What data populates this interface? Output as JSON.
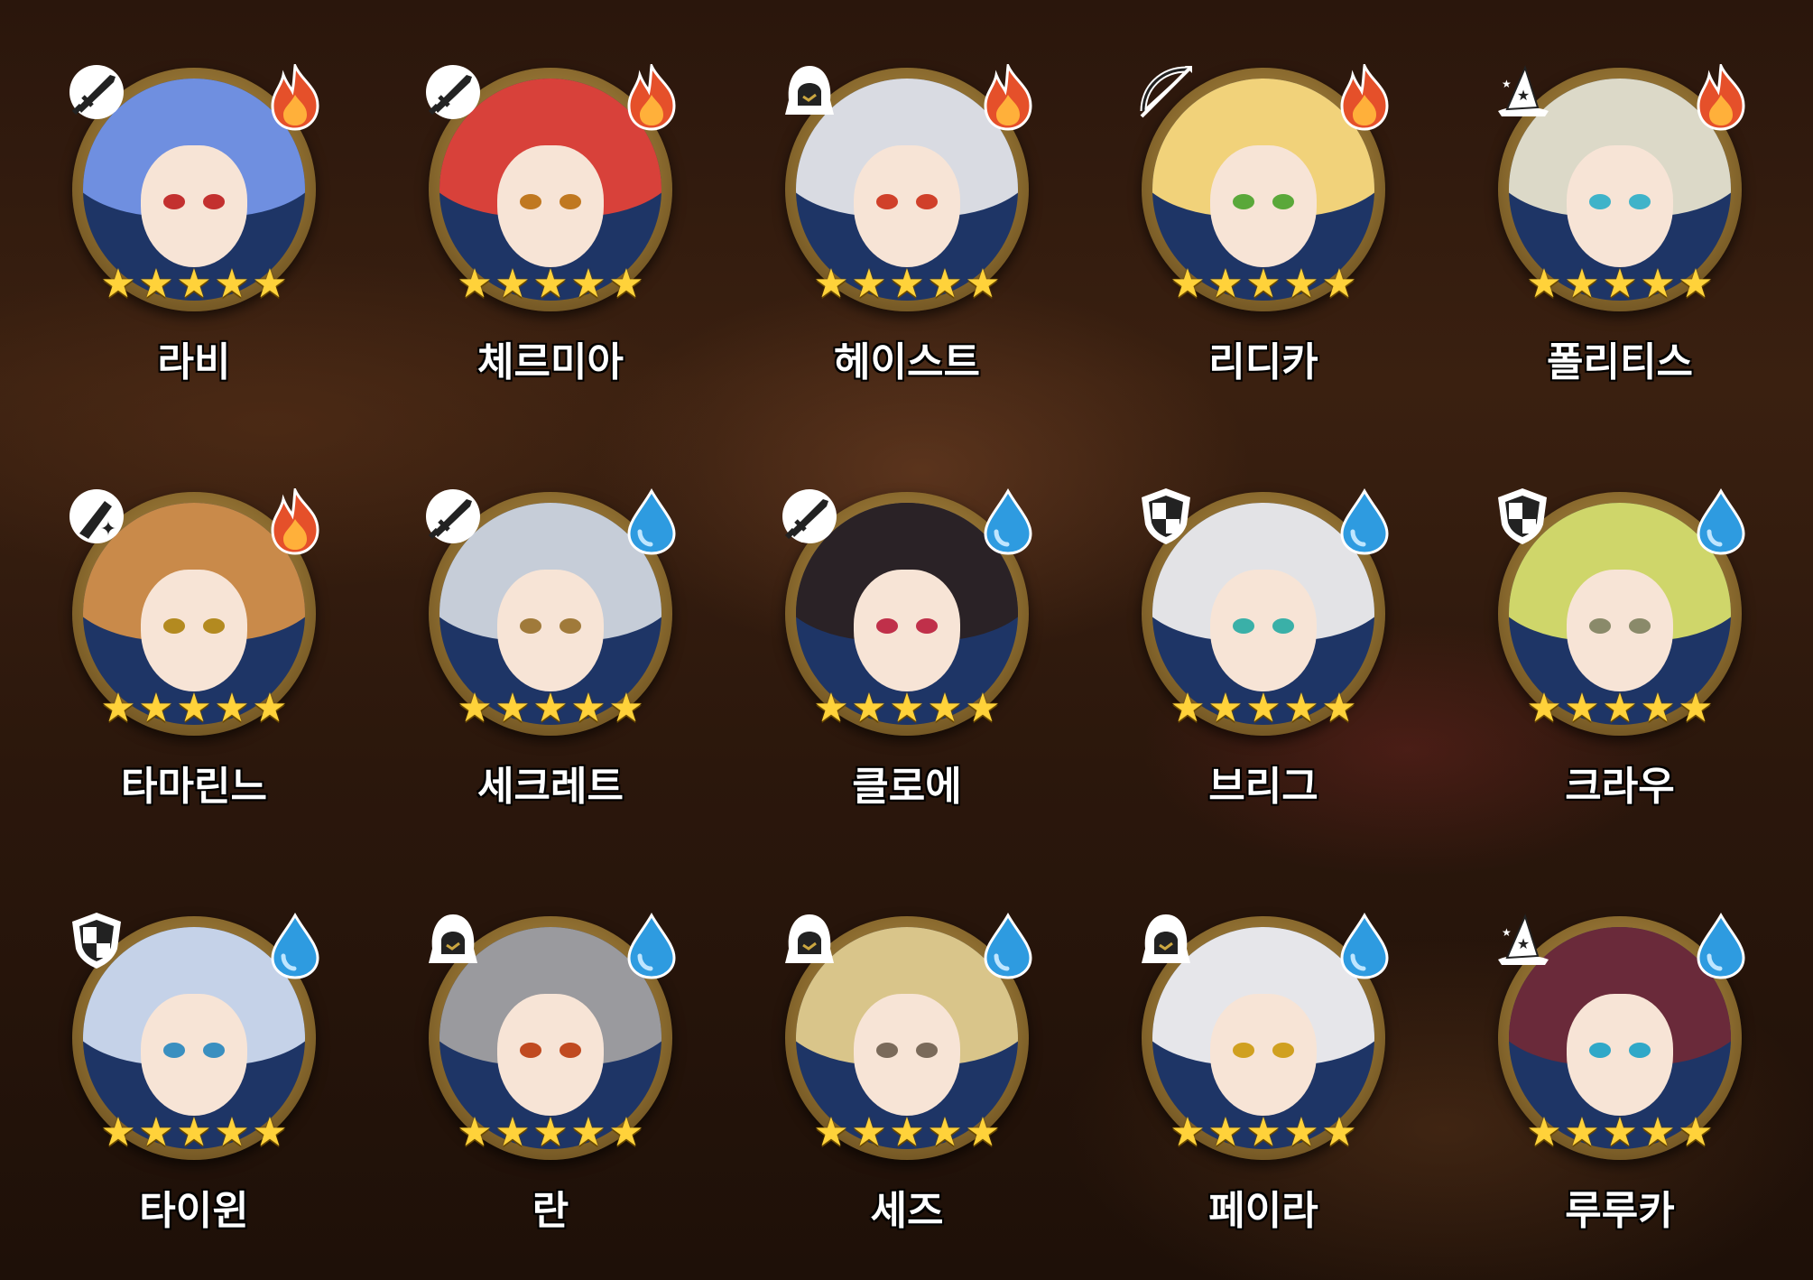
{
  "characters": [
    {
      "name": "라비",
      "role": "knight-sword",
      "element": "fire",
      "stars": 5,
      "hair": "#6f8fe0",
      "eye": "#c3302f"
    },
    {
      "name": "체르미아",
      "role": "knight-sword",
      "element": "fire",
      "stars": 5,
      "hair": "#d8413a",
      "eye": "#c07820"
    },
    {
      "name": "헤이스트",
      "role": "assassin-hood",
      "element": "fire",
      "stars": 5,
      "hair": "#d9dbe2",
      "eye": "#d0402a"
    },
    {
      "name": "리디카",
      "role": "archer-bow",
      "element": "fire",
      "stars": 5,
      "hair": "#f1d27a",
      "eye": "#5aa83a"
    },
    {
      "name": "폴리티스",
      "role": "mage-hat",
      "element": "fire",
      "stars": 5,
      "hair": "#dcd9c8",
      "eye": "#3fb3c9"
    },
    {
      "name": "타마린느",
      "role": "supporter-star",
      "element": "fire",
      "stars": 5,
      "hair": "#c98a4a",
      "eye": "#b38a20"
    },
    {
      "name": "세크레트",
      "role": "knight-sword",
      "element": "water",
      "stars": 5,
      "hair": "#c6cdd8",
      "eye": "#a07a3a"
    },
    {
      "name": "클로에",
      "role": "knight-sword",
      "element": "water",
      "stars": 5,
      "hair": "#2a2226",
      "eye": "#c0304a"
    },
    {
      "name": "브리그",
      "role": "tank-shield",
      "element": "water",
      "stars": 5,
      "hair": "#e3e3e6",
      "eye": "#3ab0a8"
    },
    {
      "name": "크라우",
      "role": "tank-shield",
      "element": "water",
      "stars": 5,
      "hair": "#cfd66a",
      "eye": "#8a8a6a"
    },
    {
      "name": "타이윈",
      "role": "tank-shield",
      "element": "water",
      "stars": 5,
      "hair": "#c5d2e8",
      "eye": "#3a8fc0"
    },
    {
      "name": "란",
      "role": "assassin-hood",
      "element": "water",
      "stars": 5,
      "hair": "#9a9a9e",
      "eye": "#c04a20"
    },
    {
      "name": "세즈",
      "role": "assassin-hood",
      "element": "water",
      "stars": 5,
      "hair": "#d9c58a",
      "eye": "#7a6a5a"
    },
    {
      "name": "페이라",
      "role": "assassin-hood",
      "element": "water",
      "stars": 5,
      "hair": "#e6e6ea",
      "eye": "#d0a020"
    },
    {
      "name": "루루카",
      "role": "mage-hat",
      "element": "water",
      "stars": 5,
      "hair": "#6a2a3a",
      "eye": "#30a8c8"
    }
  ],
  "colors": {
    "fire": "#e5502a",
    "water": "#2e9be0",
    "star": "#ffd23a",
    "frame": "#b08a3e"
  }
}
